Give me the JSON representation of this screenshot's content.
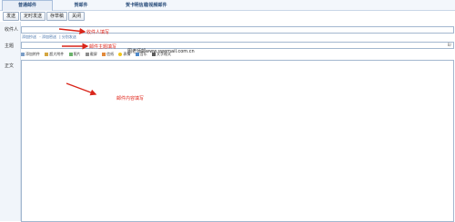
{
  "tabs": [
    {
      "label": "普通邮件"
    },
    {
      "label": "贺邮件"
    },
    {
      "label": "贺卡"
    },
    {
      "label": "明信片"
    },
    {
      "label": "音视频邮件"
    }
  ],
  "toolbar": {
    "send": "发送",
    "scheduled": "定时发送",
    "draft": "存草稿",
    "close": "关闭"
  },
  "form": {
    "to_label": "收件人",
    "subject_label": "主题",
    "body_label": "正文",
    "to_links": [
      "添加抄送",
      "- 添加密送",
      "| 分别发送"
    ],
    "to_value": "",
    "subject_value": "",
    "subject_right": "B/"
  },
  "editor_toolbar": [
    "添加附件",
    "超大附件",
    "照片",
    "截屏",
    "信纸",
    "表情",
    "音乐",
    "文字格式"
  ],
  "annotations": {
    "recipient": "收件人填写",
    "subject": "邮件主题填写",
    "body": "邮件内容填写"
  },
  "watermark": "图老师邮www.swemail.com.cn",
  "colors": {
    "annotation": "#e0261b",
    "arrow": "#d9251a"
  }
}
